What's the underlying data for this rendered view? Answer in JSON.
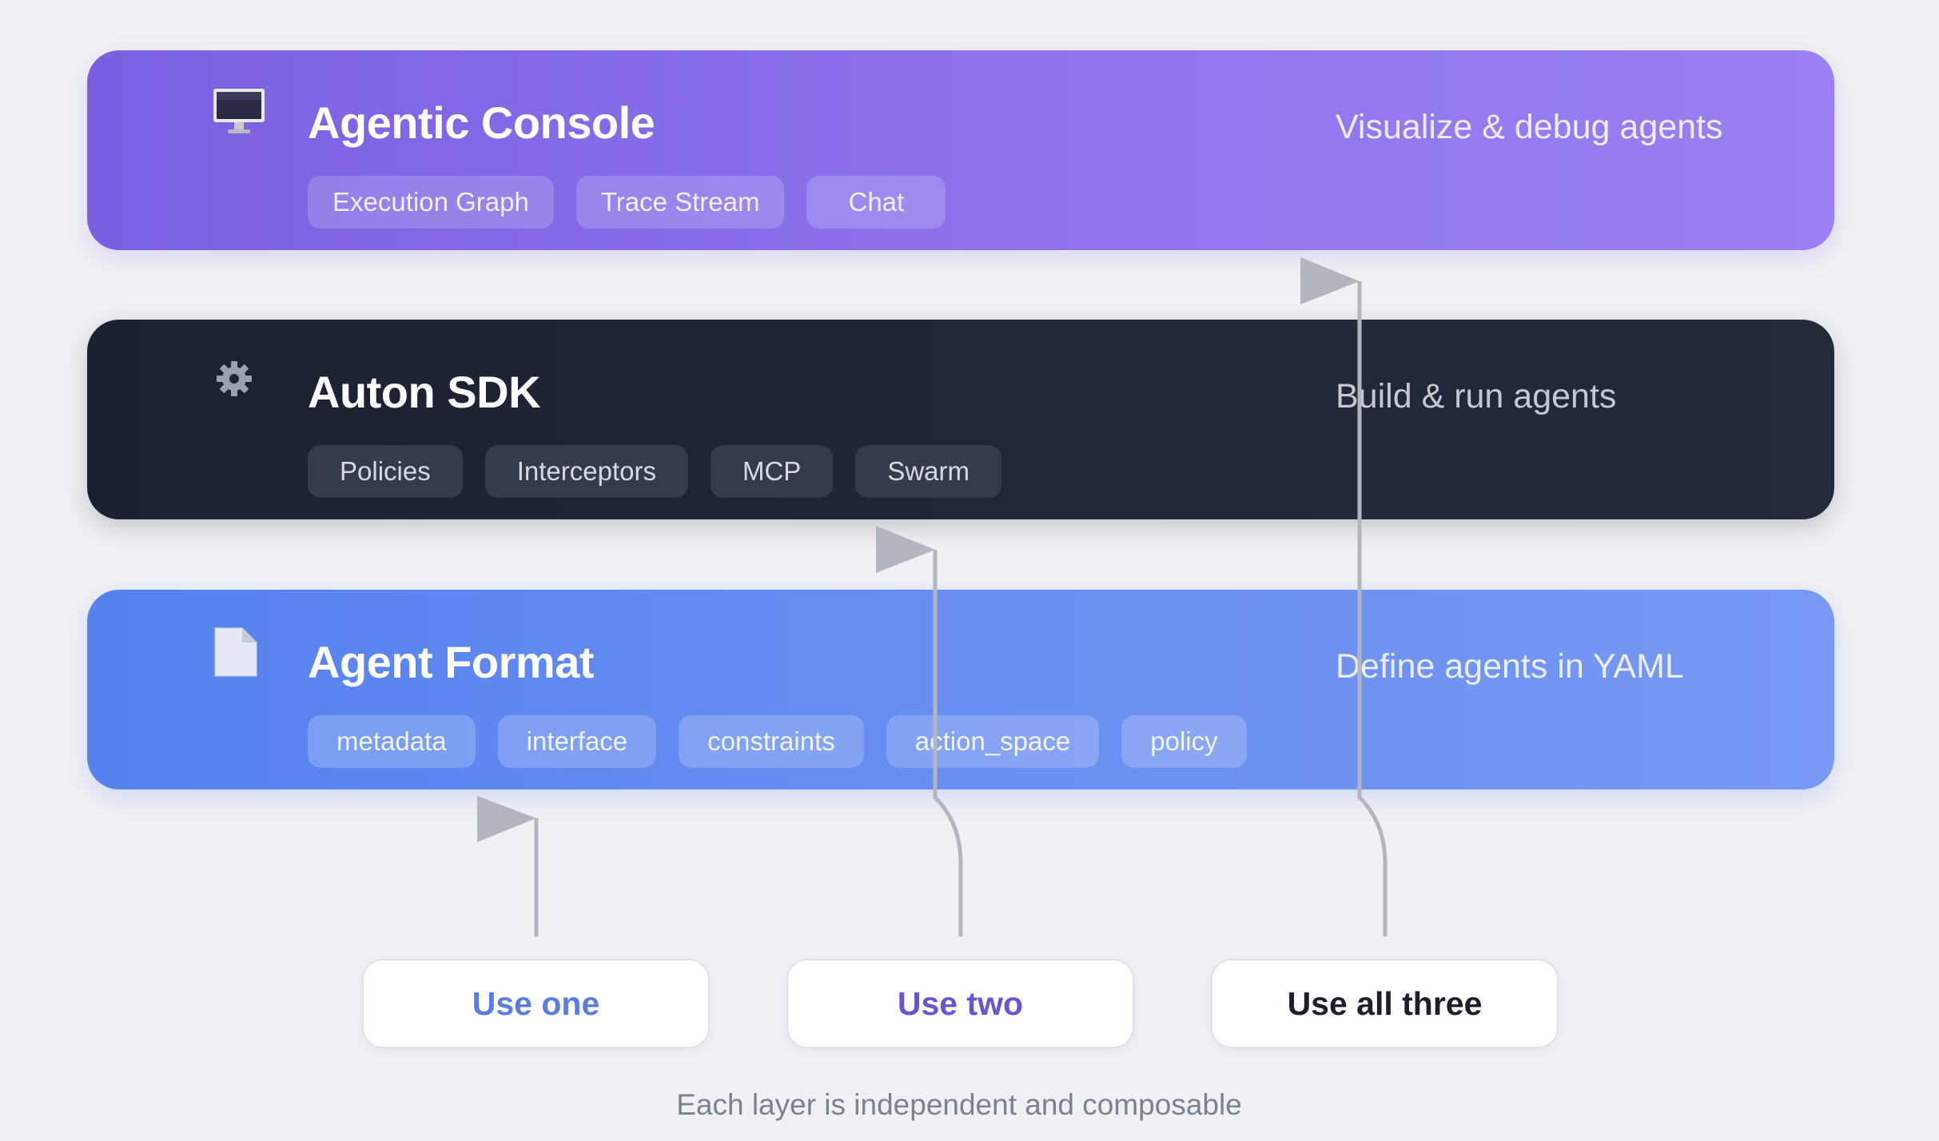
{
  "layers": {
    "console": {
      "title": "Agentic Console",
      "description": "Visualize & debug agents",
      "icon": "monitor-icon",
      "chips": [
        "Execution Graph",
        "Trace Stream",
        "Chat"
      ],
      "color": "#8a6cec"
    },
    "sdk": {
      "title": "Auton SDK",
      "description": "Build & run agents",
      "icon": "gear-icon",
      "chips": [
        "Policies",
        "Interceptors",
        "MCP",
        "Swarm"
      ],
      "color": "#1f2534"
    },
    "format": {
      "title": "Agent Format",
      "description": "Define agents in YAML",
      "icon": "document-icon",
      "chips": [
        "metadata",
        "interface",
        "constraints",
        "action_space",
        "policy"
      ],
      "color": "#6489f0"
    }
  },
  "options": {
    "one": "Use one",
    "two": "Use two",
    "three": "Use all three"
  },
  "footer": "Each layer is independent and composable"
}
